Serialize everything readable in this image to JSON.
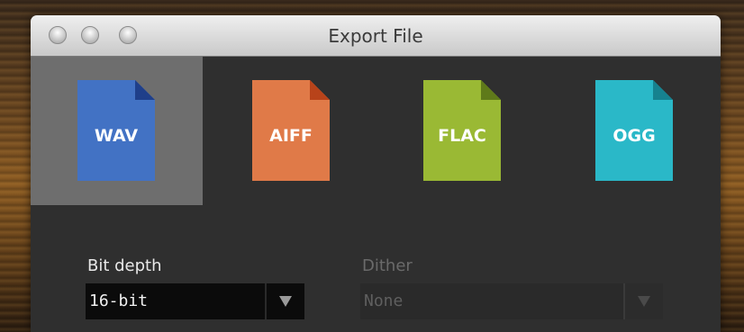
{
  "window": {
    "title": "Export File"
  },
  "formats": [
    {
      "label": "WAV",
      "color": "#4272c4",
      "fold_color": "#1f3f8a",
      "selected": true,
      "icon": "file-wav-icon"
    },
    {
      "label": "AIFF",
      "color": "#e07a48",
      "fold_color": "#b8431a",
      "selected": false,
      "icon": "file-aiff-icon"
    },
    {
      "label": "FLAC",
      "color": "#9ab934",
      "fold_color": "#5f7a1a",
      "selected": false,
      "icon": "file-flac-icon"
    },
    {
      "label": "OGG",
      "color": "#2ab8c8",
      "fold_color": "#16828f",
      "selected": false,
      "icon": "file-ogg-icon"
    }
  ],
  "bit_depth": {
    "label": "Bit depth",
    "value": "16-bit",
    "enabled": true
  },
  "dither": {
    "label": "Dither",
    "value": "None",
    "enabled": false
  }
}
